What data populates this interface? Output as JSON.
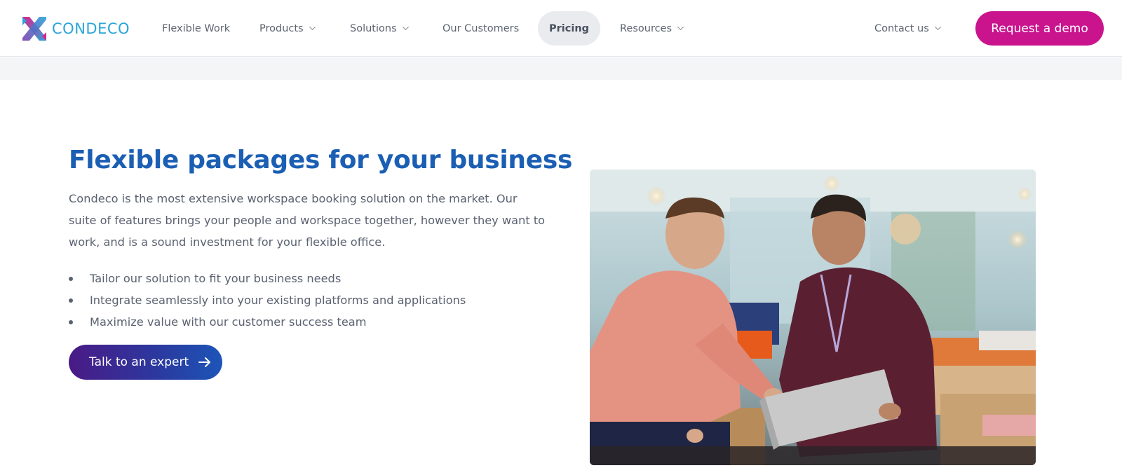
{
  "brand": {
    "name": "CONDECO",
    "accent": "#c9148e",
    "heading_blue": "#1b5fb4",
    "logo_blue": "#2aa4da"
  },
  "nav": {
    "flexible_work": "Flexible Work",
    "products": "Products",
    "solutions": "Solutions",
    "our_customers": "Our Customers",
    "pricing": "Pricing",
    "resources": "Resources",
    "contact_us": "Contact us",
    "active": "Pricing"
  },
  "header": {
    "demo_label": "Request a demo"
  },
  "main": {
    "headline": "Flexible packages for your business",
    "intro": "Condeco is the most extensive workspace booking solution on the market. Our suite of features brings your people and workspace together, however they want to work, and is a sound investment for your flexible office.",
    "bullets": [
      "Tailor our solution to fit your business needs",
      "Integrate seamlessly into your existing platforms and applications",
      "Maximize value with our customer success team"
    ],
    "cta_label": "Talk to an expert",
    "cta_icon": "arrow-right-icon"
  },
  "photo": {
    "subject": "two-men-looking-at-laptop"
  }
}
